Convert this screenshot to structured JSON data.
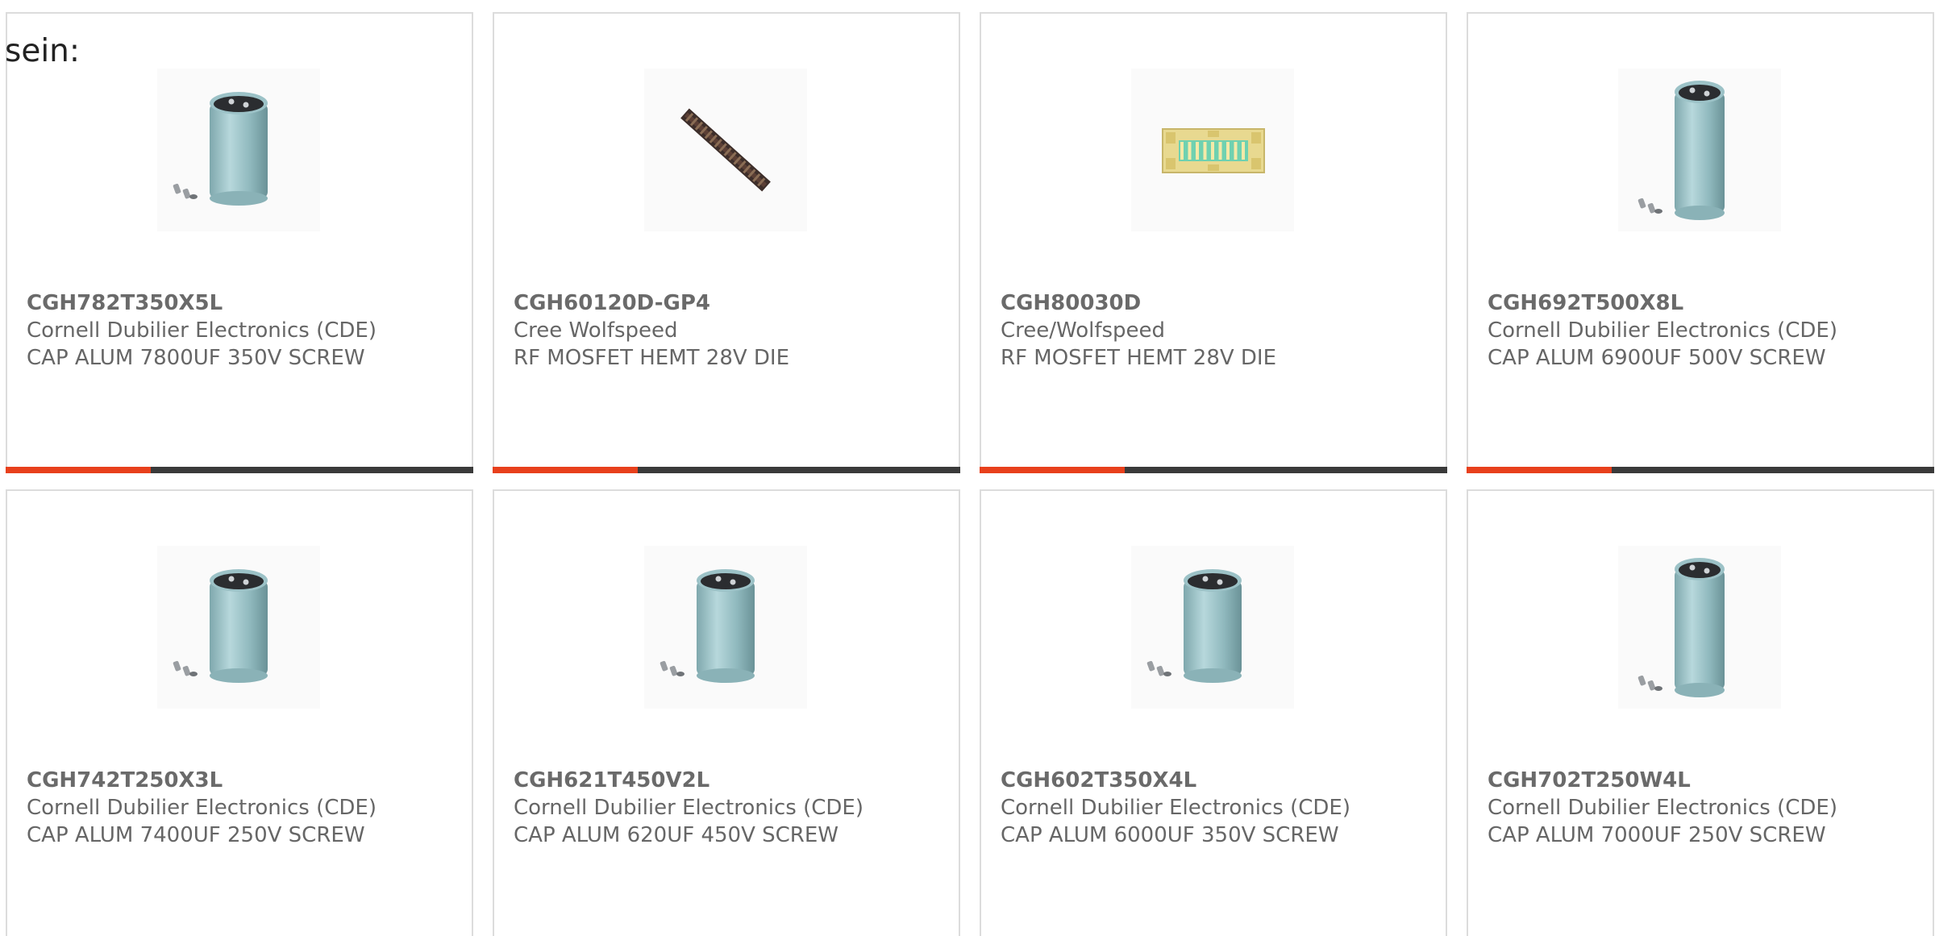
{
  "intro": {
    "text": "sein:"
  },
  "colors": {
    "accent": "#e8401c",
    "bar_dark": "#3a3a3a",
    "card_border": "#dcdcdc",
    "text": "#666666"
  },
  "products": [
    {
      "part_number": "CGH782T350X5L",
      "manufacturer": "Cornell Dubilier Electronics (CDE)",
      "description": "CAP ALUM 7800UF 350V SCREW",
      "image_icon": "capacitor-icon",
      "accent_fraction": 0.31
    },
    {
      "part_number": "CGH60120D-GP4",
      "manufacturer": "Cree Wolfspeed",
      "description": "RF MOSFET HEMT 28V DIE",
      "image_icon": "die-strip-icon",
      "accent_fraction": 0.31
    },
    {
      "part_number": "CGH80030D",
      "manufacturer": "Cree/Wolfspeed",
      "description": "RF MOSFET HEMT 28V DIE",
      "image_icon": "die-chip-icon",
      "accent_fraction": 0.31
    },
    {
      "part_number": "CGH692T500X8L",
      "manufacturer": "Cornell Dubilier Electronics (CDE)",
      "description": "CAP ALUM 6900UF 500V SCREW",
      "image_icon": "tall-capacitor-icon",
      "accent_fraction": 0.31
    },
    {
      "part_number": "CGH742T250X3L",
      "manufacturer": "Cornell Dubilier Electronics (CDE)",
      "description": "CAP ALUM 7400UF 250V SCREW",
      "image_icon": "capacitor-icon",
      "accent_fraction": 0.31
    },
    {
      "part_number": "CGH621T450V2L",
      "manufacturer": "Cornell Dubilier Electronics (CDE)",
      "description": "CAP ALUM 620UF 450V SCREW",
      "image_icon": "capacitor-icon",
      "accent_fraction": 0.31
    },
    {
      "part_number": "CGH602T350X4L",
      "manufacturer": "Cornell Dubilier Electronics (CDE)",
      "description": "CAP ALUM 6000UF 350V SCREW",
      "image_icon": "capacitor-icon",
      "accent_fraction": 0.31
    },
    {
      "part_number": "CGH702T250W4L",
      "manufacturer": "Cornell Dubilier Electronics (CDE)",
      "description": "CAP ALUM 7000UF 250V SCREW",
      "image_icon": "tall-capacitor-icon",
      "accent_fraction": 0.31
    }
  ]
}
